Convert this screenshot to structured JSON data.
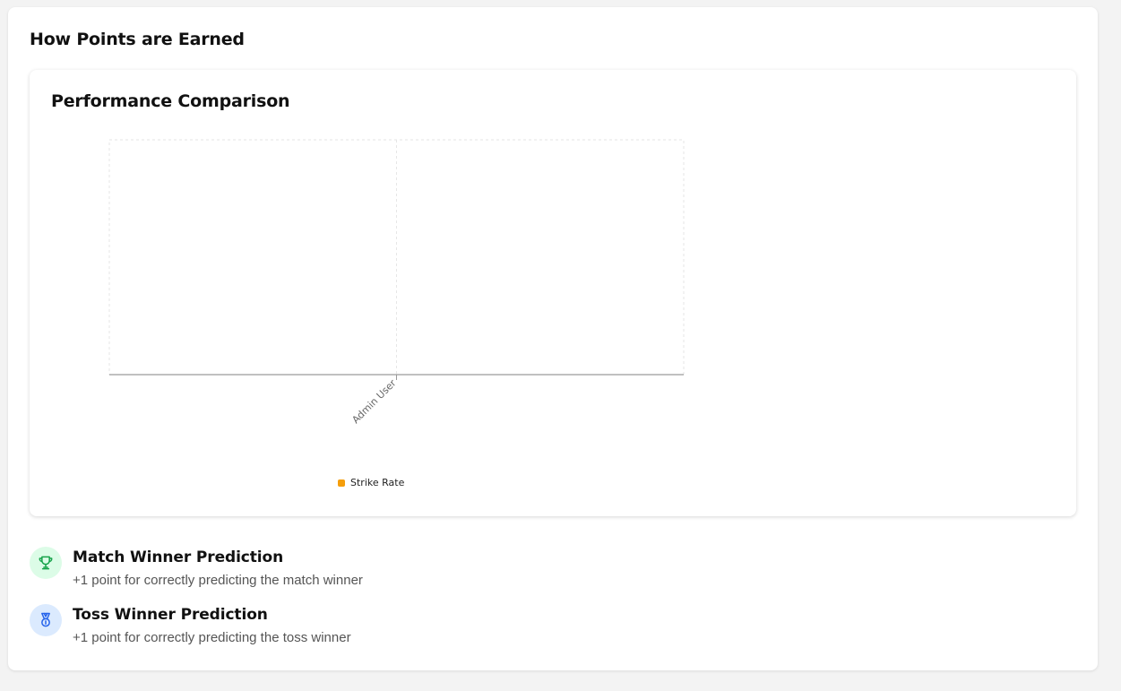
{
  "page": {
    "title": "How Points are Earned"
  },
  "chart": {
    "title": "Performance Comparison",
    "legend_color": "#f59e0b"
  },
  "chart_data": {
    "type": "bar",
    "categories": [
      "Admin User"
    ],
    "series": [
      {
        "name": "Strike Rate",
        "values": [
          0
        ]
      }
    ],
    "grid": true,
    "legend_placement": "bottom"
  },
  "rules": [
    {
      "icon": "trophy-icon",
      "icon_color": "#16a34a",
      "icon_bg": "#dcfce7",
      "title": "Match Winner Prediction",
      "description": "+1 point for correctly predicting the match winner"
    },
    {
      "icon": "medal-icon",
      "icon_color": "#2563eb",
      "icon_bg": "#dbeafe",
      "title": "Toss Winner Prediction",
      "description": "+1 point for correctly predicting the toss winner"
    }
  ]
}
